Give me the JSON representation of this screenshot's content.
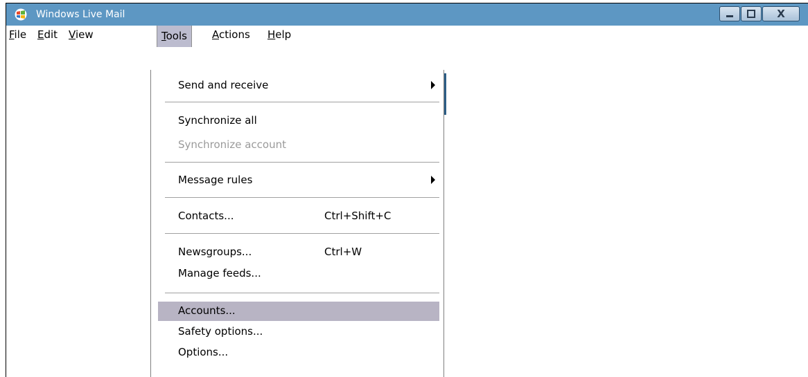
{
  "window": {
    "title": "Windows Live Mail",
    "icon": "windows-live-mail-icon",
    "controls": {
      "minimize": "_",
      "maximize": "□",
      "close": "X"
    }
  },
  "menubar": {
    "items": [
      {
        "label": "File",
        "accel": "F",
        "rest": "ile"
      },
      {
        "label": "Edit",
        "accel": "E",
        "rest": "dit"
      },
      {
        "label": "View",
        "accel": "V",
        "rest": "iew"
      },
      {
        "label": "Tools",
        "accel": "T",
        "rest": "ools"
      },
      {
        "label": "Actions",
        "accel": "A",
        "rest": "ctions"
      },
      {
        "label": "Help",
        "accel": "H",
        "rest": "elp"
      }
    ],
    "active": "Tools"
  },
  "tools_menu": {
    "items": [
      {
        "label": "Send and receive",
        "submenu": true
      },
      {
        "label": "Synchronize all"
      },
      {
        "label": "Synchronize account",
        "disabled": true
      },
      {
        "label": "Message rules",
        "submenu": true
      },
      {
        "label": "Contacts...",
        "shortcut": "Ctrl+Shift+C"
      },
      {
        "label": "Newsgroups...",
        "shortcut": "Ctrl+W"
      },
      {
        "label": "Manage feeds..."
      },
      {
        "label": "Accounts...",
        "highlighted": true
      },
      {
        "label": "Safety options..."
      },
      {
        "label": "Options..."
      }
    ]
  },
  "colors": {
    "titlebar": "#5d97c3",
    "menu_highlight": "#b8b4c4",
    "disabled_text": "#9a9a9a"
  }
}
